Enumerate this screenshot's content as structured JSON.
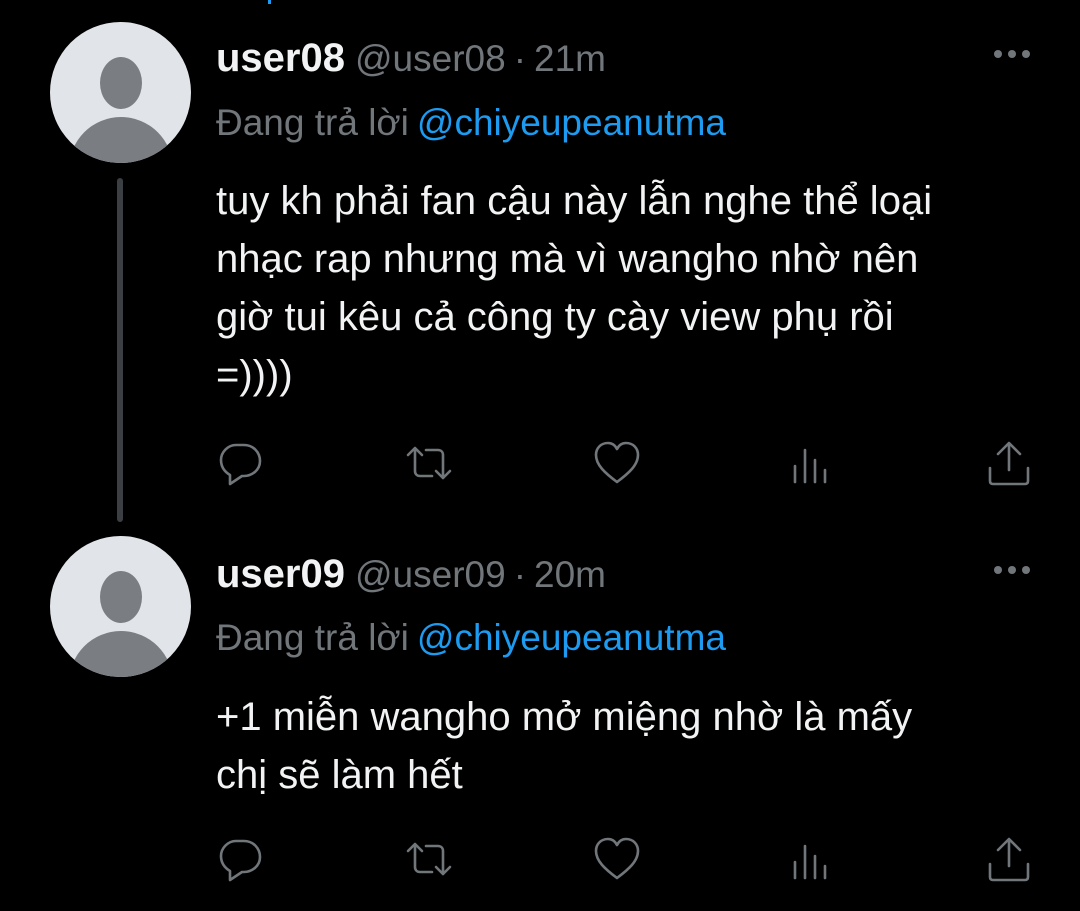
{
  "tweets": [
    {
      "name": "user08",
      "handle": "@user08",
      "separator": "·",
      "time": "21m",
      "reply_prefix": "Đang trả lời",
      "reply_to": "@chiyeupeanutma",
      "text": "tuy kh phải fan cậu này lẫn nghe thể loại\nnhạc rap nhưng mà vì wangho nhờ nên\ngiờ tui kêu cả công ty cày view phụ rồi\n=))))",
      "avatar_icon": "default-avatar-icon",
      "actions": [
        "reply-icon",
        "retweet-icon",
        "like-icon",
        "views-icon",
        "share-icon"
      ]
    },
    {
      "name": "user09",
      "handle": "@user09",
      "separator": "·",
      "time": "20m",
      "reply_prefix": "Đang trả lời",
      "reply_to": "@chiyeupeanutma",
      "text": "+1 miễn wangho mở miệng nhờ là mấy\nchị sẽ làm hết",
      "avatar_icon": "default-avatar-icon",
      "actions": [
        "reply-icon",
        "retweet-icon",
        "like-icon",
        "views-icon",
        "share-icon"
      ]
    }
  ],
  "colors": {
    "background": "#000000",
    "primary_text": "#f2f3f4",
    "secondary_text": "#71767b",
    "accent": "#1d9bf0",
    "thread_line": "#3b3e42",
    "avatar_bg": "#e1e4e8",
    "avatar_fg": "#7a7d81"
  }
}
